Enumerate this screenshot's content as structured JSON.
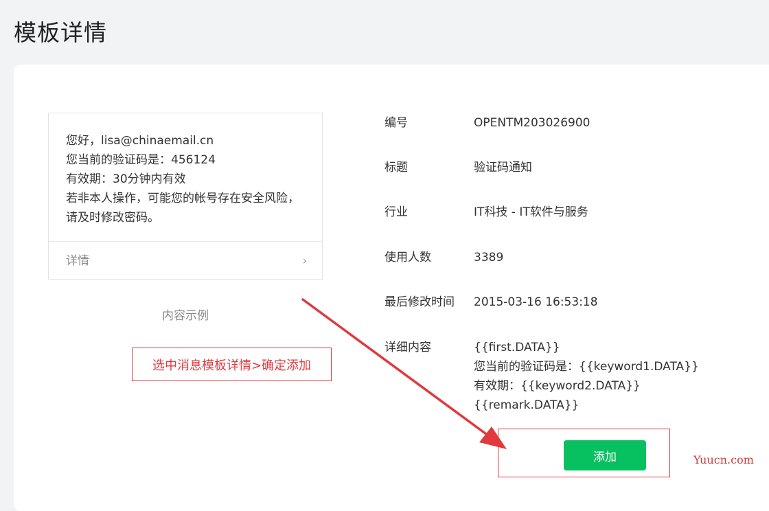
{
  "page": {
    "title": "模板详情"
  },
  "preview": {
    "lines": [
      "您好，lisa@chinaemail.cn",
      "您当前的验证码是：456124",
      "有效期：30分钟内有效",
      "若非本人操作，可能您的帐号存在安全风险，",
      "请及时修改密码。"
    ],
    "detail_label": "详情",
    "chevron": "›",
    "caption": "内容示例"
  },
  "info": {
    "rows": [
      {
        "label": "编号",
        "value": "OPENTM203026900"
      },
      {
        "label": "标题",
        "value": "验证码通知"
      },
      {
        "label": "行业",
        "value": "IT科技 - IT软件与服务"
      },
      {
        "label": "使用人数",
        "value": "3389"
      },
      {
        "label": "最后修改时间",
        "value": "2015-03-16 16:53:18"
      }
    ],
    "detail_content": {
      "label": "详细内容",
      "lines": [
        "{{first.DATA}}",
        "您当前的验证码是：{{keyword1.DATA}}",
        "有效期：{{keyword2.DATA}}",
        "{{remark.DATA}}"
      ]
    }
  },
  "actions": {
    "add_label": "添加"
  },
  "annotation": {
    "text": "选中消息模板详情>确定添加"
  },
  "watermark": {
    "text": "Yuucn.com"
  },
  "colors": {
    "accent_green": "#07c160",
    "annotation_red": "#e0393e"
  },
  "icons": {
    "detail_chevron": "chevron-right-icon"
  }
}
